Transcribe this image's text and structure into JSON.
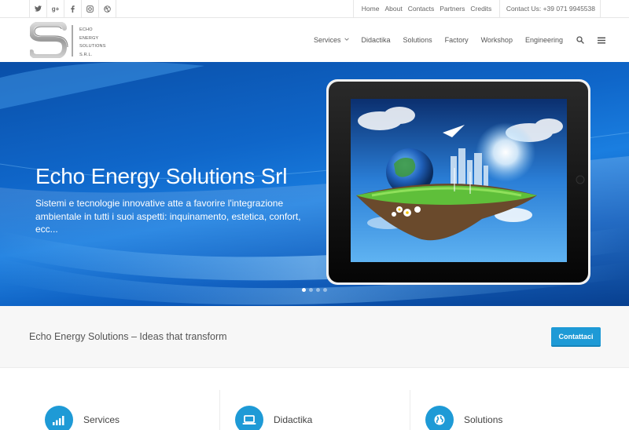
{
  "social": [
    {
      "icon": "twitter-icon",
      "glyph": "t"
    },
    {
      "icon": "google-plus-icon",
      "glyph": "g+"
    },
    {
      "icon": "facebook-icon",
      "glyph": "f"
    },
    {
      "icon": "instagram-icon",
      "glyph": "◙"
    },
    {
      "icon": "dribbble-icon",
      "glyph": "◎"
    }
  ],
  "top_links": [
    "Home",
    "About",
    "Contacts",
    "Partners",
    "Credits"
  ],
  "contact": "Contact Us: +39 071 9945538",
  "logo": {
    "lines": [
      "ECHO",
      "ENERGY",
      "SOLUTIONS",
      "S.R.L."
    ]
  },
  "nav": {
    "items": [
      "Services",
      "Didactika",
      "Solutions",
      "Factory",
      "Workshop",
      "Engineering"
    ]
  },
  "hero": {
    "title": "Echo Energy Solutions Srl",
    "description": "Sistemi e tecnologie innovative atte a favorire l'integrazione ambientale in tutti i suoi aspetti: inquinamento, estetica, confort, ecc...",
    "slides_total": 4,
    "active_slide": 1
  },
  "tagline": "Echo Energy Solutions – Ideas that transform",
  "cta_label": "Contattaci",
  "features": [
    {
      "label": "Services",
      "icon": "signal-bars-icon"
    },
    {
      "label": "Didactika",
      "icon": "laptop-icon"
    },
    {
      "label": "Solutions",
      "icon": "globe-icon"
    }
  ],
  "colors": {
    "accent": "#1e9ad6",
    "hero_blue": "#0f66c9"
  }
}
